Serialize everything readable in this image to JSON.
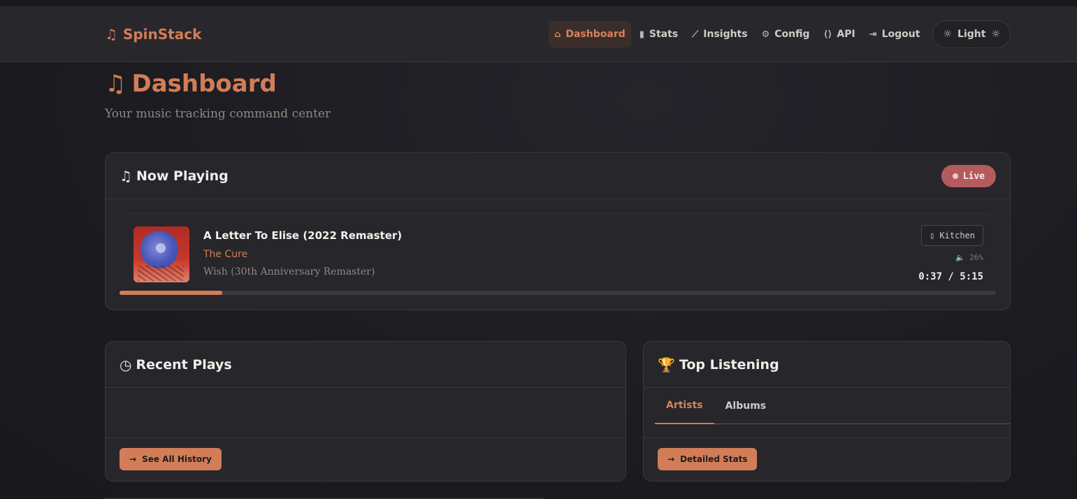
{
  "brand": {
    "name": "SpinStack",
    "icon": "music-note-icon"
  },
  "nav": {
    "items": [
      {
        "label": "Dashboard",
        "icon": "home-icon",
        "active": true
      },
      {
        "label": "Stats",
        "icon": "bar-chart-icon"
      },
      {
        "label": "Insights",
        "icon": "line-chart-icon"
      },
      {
        "label": "Config",
        "icon": "gear-icon"
      },
      {
        "label": "API",
        "icon": "code-icon"
      },
      {
        "label": "Logout",
        "icon": "logout-icon"
      }
    ],
    "theme_toggle": "Light"
  },
  "page": {
    "title": "Dashboard",
    "subtitle": "Your music tracking command center"
  },
  "now_playing": {
    "title": "Now Playing",
    "badge": "Live",
    "track": {
      "title": "A Letter To Elise (2022 Remaster)",
      "artist": "The Cure",
      "album": "Wish (30th Anniversary Remaster)"
    },
    "device": "Kitchen",
    "volume": "26%",
    "time": "0:37 / 5:15",
    "progress": 0.117
  },
  "recent": {
    "title": "Recent Plays",
    "button": "See All History"
  },
  "top": {
    "title": "Top Listening",
    "tabs": [
      {
        "label": "Artists",
        "active": true
      },
      {
        "label": "Albums"
      }
    ],
    "button": "Detailed Stats"
  },
  "colors": {
    "accent": "#d27d58",
    "live": "#b45b5e",
    "background": "#1c1b20",
    "card": "#27262b"
  }
}
